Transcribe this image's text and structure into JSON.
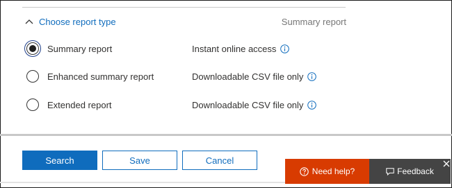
{
  "section": {
    "title": "Choose report type",
    "selected_value": "Summary report"
  },
  "options": [
    {
      "label": "Summary report",
      "description": "Instant online access",
      "selected": true
    },
    {
      "label": "Enhanced summary report",
      "description": "Downloadable CSV file only",
      "selected": false
    },
    {
      "label": "Extended report",
      "description": "Downloadable CSV file only",
      "selected": false
    }
  ],
  "actions": {
    "search_label": "Search",
    "save_label": "Save",
    "cancel_label": "Cancel"
  },
  "help": {
    "need_help_label": "Need help?",
    "feedback_label": "Feedback"
  },
  "colors": {
    "accent": "#0f6cbd",
    "help_background": "#d83b01",
    "feedback_background": "#444444"
  },
  "icons": {
    "collapse": "chevron-up-icon",
    "info": "info-icon",
    "help": "question-circle-icon",
    "feedback": "speech-bubble-icon",
    "close": "close-icon"
  }
}
